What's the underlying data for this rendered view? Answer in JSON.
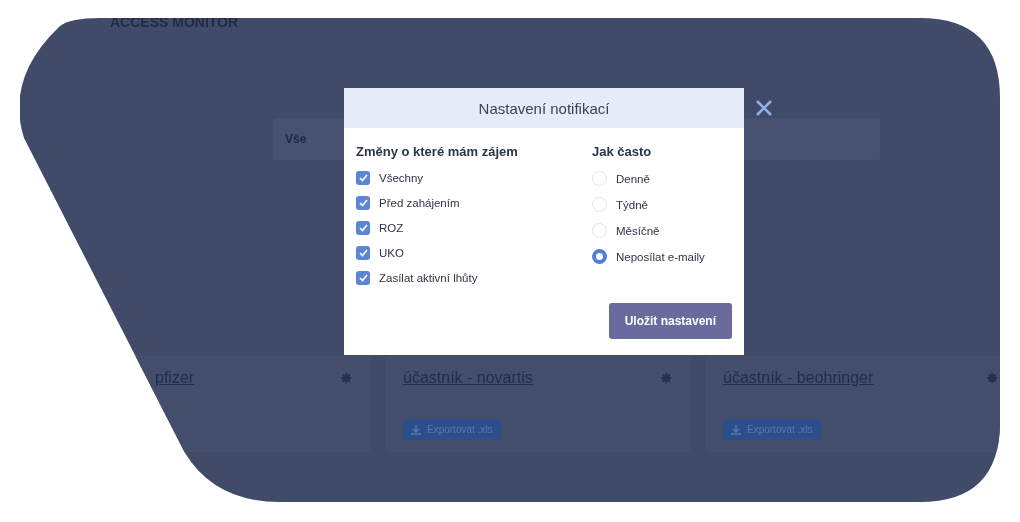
{
  "page": {
    "logo": "ACCESS MONITOR",
    "filter": {
      "value": "Vše"
    },
    "cards": [
      {
        "title": "pfizer"
      },
      {
        "title": "účastník - novartis",
        "export": "Exportovat .xls"
      },
      {
        "title": "účastník - beohringer",
        "export": "Exportovat .xls"
      }
    ]
  },
  "dialog": {
    "title": "Nastavení notifikací",
    "changes": {
      "heading": "Změny o které mám zájem",
      "items": [
        {
          "label": "Všechny",
          "checked": true
        },
        {
          "label": "Před zahájením",
          "checked": true
        },
        {
          "label": "ROZ",
          "checked": true
        },
        {
          "label": "UKO",
          "checked": true
        },
        {
          "label": "Zasílat aktivní lhůty",
          "checked": true
        }
      ]
    },
    "frequency": {
      "heading": "Jak často",
      "items": [
        {
          "label": "Denně",
          "selected": false
        },
        {
          "label": "Týdně",
          "selected": false
        },
        {
          "label": "Měsíčně",
          "selected": false
        },
        {
          "label": "Neposílat e-maily",
          "selected": true
        }
      ]
    },
    "save_button": "Uložit nastavení"
  }
}
